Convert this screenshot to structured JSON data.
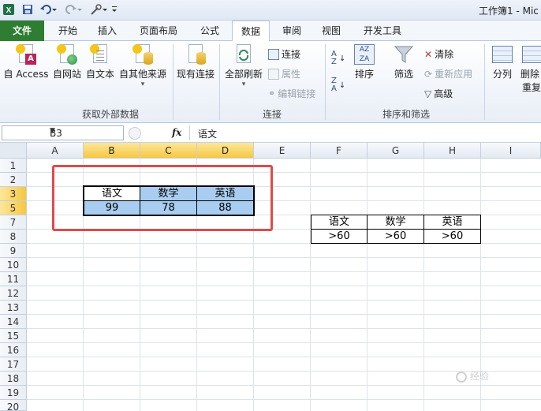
{
  "app": {
    "title": "工作簿1 - Mic"
  },
  "tabs": [
    {
      "label": "文件"
    },
    {
      "label": "开始"
    },
    {
      "label": "插入"
    },
    {
      "label": "页面布局"
    },
    {
      "label": "公式"
    },
    {
      "label": "数据"
    },
    {
      "label": "审阅"
    },
    {
      "label": "视图"
    },
    {
      "label": "开发工具"
    }
  ],
  "ribbon": {
    "group1": {
      "label": "获取外部数据",
      "buttons": [
        "自 Access",
        "自网站",
        "自文本",
        "自其他来源"
      ]
    },
    "existing": "现有连接",
    "refresh_all": "全部刷新",
    "group2": {
      "label": "连接",
      "connect": "连接",
      "properties": "属性",
      "edit_links": "编辑链接"
    },
    "group3": {
      "label": "排序和筛选",
      "sort": "排序",
      "filter": "筛选",
      "clear": "清除",
      "reapply": "重新应用",
      "advanced": "高级"
    },
    "split": "分列",
    "delete": "删除",
    "dup": "重复"
  },
  "formula_bar": {
    "name": "B3",
    "fx": "fx",
    "value": "语文"
  },
  "columns": [
    "A",
    "B",
    "C",
    "D",
    "E",
    "F",
    "G",
    "H",
    "I"
  ],
  "rows": [
    "1",
    "2",
    "3",
    "5",
    "7",
    "8",
    "9",
    "10",
    "11",
    "12",
    "13",
    "14",
    "15",
    "16",
    "17",
    "18",
    "19",
    "20"
  ],
  "data_table": {
    "headers": [
      "语文",
      "数学",
      "英语"
    ],
    "values": [
      "99",
      "78",
      "88"
    ]
  },
  "criteria_table": {
    "headers": [
      "语文",
      "数学",
      "英语"
    ],
    "values": [
      ">60",
      ">60",
      ">60"
    ]
  },
  "watermark": "经验"
}
